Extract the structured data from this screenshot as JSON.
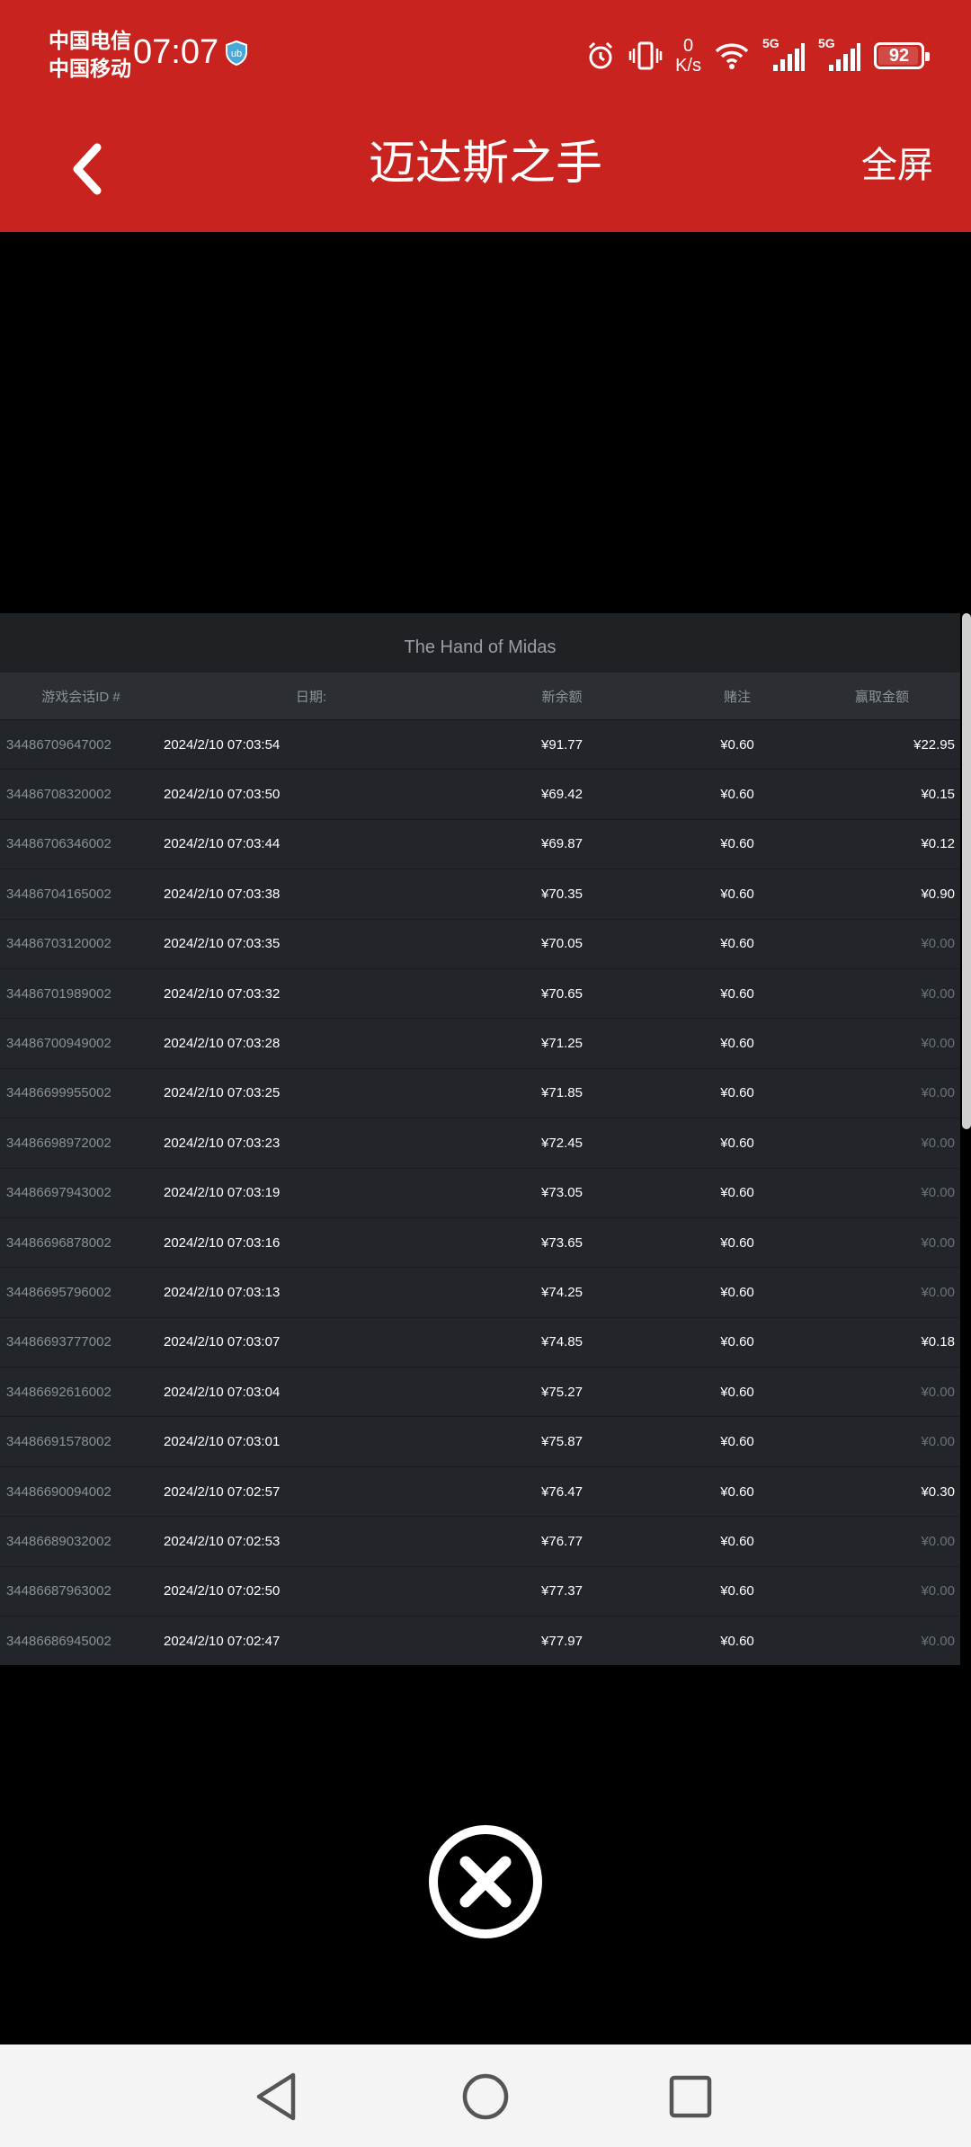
{
  "status_bar": {
    "carrier1": "中国电信",
    "carrier2": "中国移动",
    "time": "07:07",
    "speed_value": "0",
    "speed_unit": "K/s",
    "signal1": "5G",
    "signal2": "5G",
    "battery": "92"
  },
  "app_bar": {
    "title": "迈达斯之手",
    "fullscreen_label": "全屏"
  },
  "panel": {
    "title": "The Hand of Midas",
    "columns": [
      "游戏会话ID #",
      "日期:",
      "新余额",
      "赌注",
      "赢取金额"
    ],
    "rows": [
      {
        "id": "34486709647002",
        "date": "2024/2/10 07:03:54",
        "balance": "¥91.77",
        "bet": "¥0.60",
        "win": "¥22.95"
      },
      {
        "id": "34486708320002",
        "date": "2024/2/10 07:03:50",
        "balance": "¥69.42",
        "bet": "¥0.60",
        "win": "¥0.15"
      },
      {
        "id": "34486706346002",
        "date": "2024/2/10 07:03:44",
        "balance": "¥69.87",
        "bet": "¥0.60",
        "win": "¥0.12"
      },
      {
        "id": "34486704165002",
        "date": "2024/2/10 07:03:38",
        "balance": "¥70.35",
        "bet": "¥0.60",
        "win": "¥0.90"
      },
      {
        "id": "34486703120002",
        "date": "2024/2/10 07:03:35",
        "balance": "¥70.05",
        "bet": "¥0.60",
        "win": "¥0.00"
      },
      {
        "id": "34486701989002",
        "date": "2024/2/10 07:03:32",
        "balance": "¥70.65",
        "bet": "¥0.60",
        "win": "¥0.00"
      },
      {
        "id": "34486700949002",
        "date": "2024/2/10 07:03:28",
        "balance": "¥71.25",
        "bet": "¥0.60",
        "win": "¥0.00"
      },
      {
        "id": "34486699955002",
        "date": "2024/2/10 07:03:25",
        "balance": "¥71.85",
        "bet": "¥0.60",
        "win": "¥0.00"
      },
      {
        "id": "34486698972002",
        "date": "2024/2/10 07:03:23",
        "balance": "¥72.45",
        "bet": "¥0.60",
        "win": "¥0.00"
      },
      {
        "id": "34486697943002",
        "date": "2024/2/10 07:03:19",
        "balance": "¥73.05",
        "bet": "¥0.60",
        "win": "¥0.00"
      },
      {
        "id": "34486696878002",
        "date": "2024/2/10 07:03:16",
        "balance": "¥73.65",
        "bet": "¥0.60",
        "win": "¥0.00"
      },
      {
        "id": "34486695796002",
        "date": "2024/2/10 07:03:13",
        "balance": "¥74.25",
        "bet": "¥0.60",
        "win": "¥0.00"
      },
      {
        "id": "34486693777002",
        "date": "2024/2/10 07:03:07",
        "balance": "¥74.85",
        "bet": "¥0.60",
        "win": "¥0.18"
      },
      {
        "id": "34486692616002",
        "date": "2024/2/10 07:03:04",
        "balance": "¥75.27",
        "bet": "¥0.60",
        "win": "¥0.00"
      },
      {
        "id": "34486691578002",
        "date": "2024/2/10 07:03:01",
        "balance": "¥75.87",
        "bet": "¥0.60",
        "win": "¥0.00"
      },
      {
        "id": "34486690094002",
        "date": "2024/2/10 07:02:57",
        "balance": "¥76.47",
        "bet": "¥0.60",
        "win": "¥0.30"
      },
      {
        "id": "34486689032002",
        "date": "2024/2/10 07:02:53",
        "balance": "¥76.77",
        "bet": "¥0.60",
        "win": "¥0.00"
      },
      {
        "id": "34486687963002",
        "date": "2024/2/10 07:02:50",
        "balance": "¥77.37",
        "bet": "¥0.60",
        "win": "¥0.00"
      },
      {
        "id": "34486686945002",
        "date": "2024/2/10 07:02:47",
        "balance": "¥77.97",
        "bet": "¥0.60",
        "win": "¥0.00"
      }
    ]
  },
  "colors": {
    "brand_red": "#c8231e",
    "panel_bg": "#22262a",
    "muted_text": "#8c9197"
  },
  "icons": {
    "back": "chevron-left-icon",
    "close": "close-circle-icon",
    "nav_back": "triangle-back-icon",
    "nav_home": "circle-home-icon",
    "nav_recents": "square-recents-icon"
  }
}
